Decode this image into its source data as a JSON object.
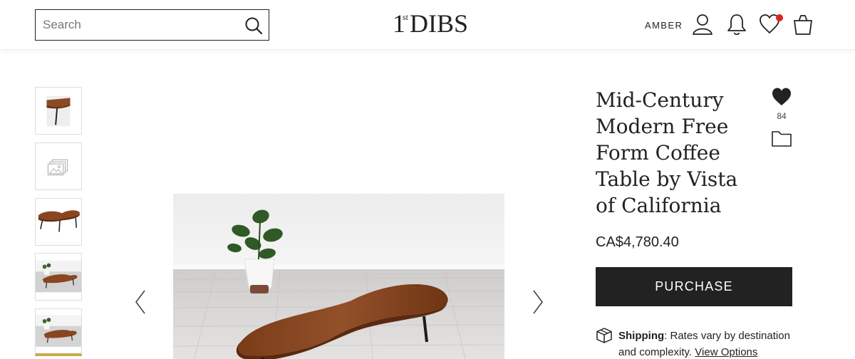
{
  "header": {
    "search_placeholder": "Search",
    "logo": {
      "one": "1",
      "st": "st",
      "dibs": "DIBS"
    },
    "user_name": "AMBER",
    "icons": [
      "search-icon",
      "user-icon",
      "bell-icon",
      "heart-outline-icon",
      "shopping-bag-icon"
    ],
    "notification_dot_color": "#e0201b"
  },
  "gallery": {
    "thumbnails": [
      "table-corner-closeup",
      "more-images-placeholder",
      "table-side-view",
      "table-room-view",
      "table-room-view-alt"
    ],
    "active_thumbnail": 4,
    "active_color": "#c8a84e",
    "prev_icon": "chevron-left-icon",
    "next_icon": "chevron-right-icon"
  },
  "product": {
    "title": "Mid-Century Modern Free Form Coffee Table by Vista of California",
    "favorite_count": "84",
    "price": "CA$4,780.40",
    "purchase_label": "PURCHASE",
    "shipping": {
      "label": "Shipping",
      "text": ": Rates vary by destination and complexity. ",
      "link": "View Options"
    }
  }
}
